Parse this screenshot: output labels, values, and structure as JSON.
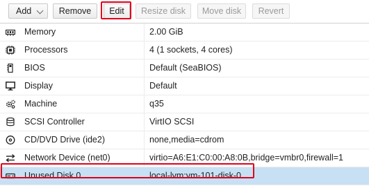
{
  "toolbar": {
    "add": "Add",
    "remove": "Remove",
    "edit": "Edit",
    "resize_disk": "Resize disk",
    "move_disk": "Move disk",
    "revert": "Revert"
  },
  "hardware": [
    {
      "key": "Memory",
      "value": "2.00 GiB",
      "icon": "memory-icon"
    },
    {
      "key": "Processors",
      "value": "4 (1 sockets, 4 cores)",
      "icon": "cpu-icon"
    },
    {
      "key": "BIOS",
      "value": "Default (SeaBIOS)",
      "icon": "bios-icon"
    },
    {
      "key": "Display",
      "value": "Default",
      "icon": "monitor-icon"
    },
    {
      "key": "Machine",
      "value": "q35",
      "icon": "gears-icon"
    },
    {
      "key": "SCSI Controller",
      "value": "VirtIO SCSI",
      "icon": "database-icon"
    },
    {
      "key": "CD/DVD Drive (ide2)",
      "value": "none,media=cdrom",
      "icon": "cdrom-icon"
    },
    {
      "key": "Network Device (net0)",
      "value": "virtio=A6:E1:C0:00:A8:0B,bridge=vmbr0,firewall=1",
      "icon": "exchange-icon"
    },
    {
      "key": "Unused Disk 0",
      "value": "local-lvm:vm-101-disk-0",
      "icon": "hdd-icon"
    }
  ],
  "colors": {
    "highlight": "#e0001a",
    "selected_row": "#c8e0f4"
  }
}
